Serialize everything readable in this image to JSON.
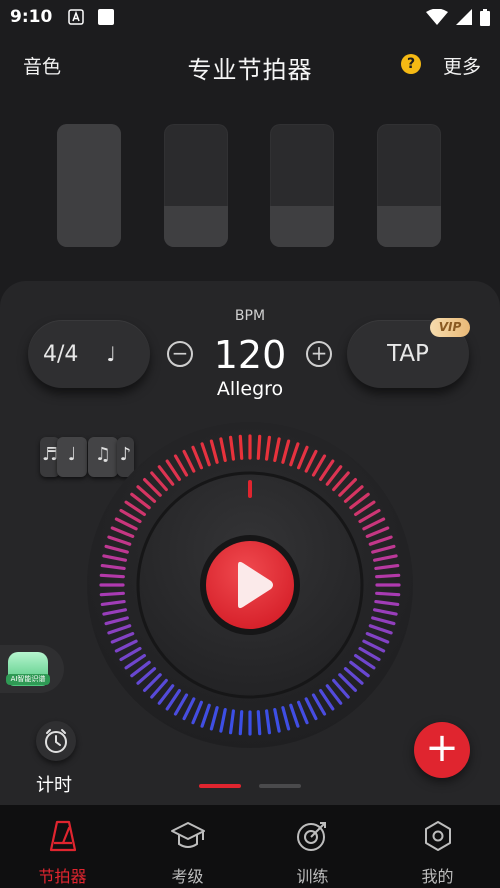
{
  "status_bar": {
    "time": "9:10"
  },
  "header": {
    "left_label": "音色",
    "title": "专业节拍器",
    "help_glyph": "?",
    "right_label": "更多"
  },
  "beats": [
    {
      "level": 1.0
    },
    {
      "level": 0.33
    },
    {
      "level": 0.33
    },
    {
      "level": 0.33
    }
  ],
  "controls": {
    "meter": "4/4",
    "meter_note": "♩",
    "bpm_label": "BPM",
    "bpm": "120",
    "tempo": "Allegro",
    "minus_glyph": "−",
    "plus_glyph": "+",
    "tap_label": "TAP",
    "vip_badge": "VIP"
  },
  "rhythms": [
    "♬",
    "♩",
    "♫",
    "♪"
  ],
  "ai_badge_label": "AI智能识谱",
  "timer_label": "计时",
  "add_glyph": "+",
  "pager": {
    "count": 2,
    "active": 0
  },
  "tabs": [
    {
      "label": "节拍器",
      "icon": "metronome-icon",
      "active": true
    },
    {
      "label": "考级",
      "icon": "graduation-cap-icon",
      "active": false
    },
    {
      "label": "训练",
      "icon": "target-icon",
      "active": false
    },
    {
      "label": "我的",
      "icon": "hexagon-profile-icon",
      "active": false
    }
  ],
  "colors": {
    "accent": "#e0252f",
    "ring_top": "#e8323a",
    "ring_mid": "#b03ab0",
    "ring_bottom": "#3b4fe6"
  }
}
